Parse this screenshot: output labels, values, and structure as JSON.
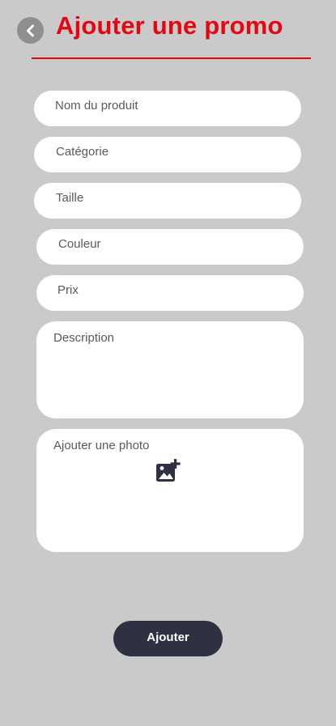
{
  "header": {
    "title": "Ajouter une promo",
    "back_icon": "chevron-left-icon",
    "title_color": "#e30613"
  },
  "form": {
    "product_name": {
      "placeholder": "Nom du produit",
      "value": ""
    },
    "category": {
      "placeholder": "Catégorie",
      "value": ""
    },
    "size": {
      "placeholder": "Taille",
      "value": ""
    },
    "color": {
      "placeholder": "Couleur",
      "value": ""
    },
    "price": {
      "placeholder": "Prix",
      "value": ""
    },
    "description": {
      "placeholder": "Description",
      "value": ""
    },
    "photo": {
      "label": "Ajouter une photo",
      "icon": "add-photo-icon"
    }
  },
  "actions": {
    "submit_label": "Ajouter",
    "submit_color": "#2e3141"
  },
  "theme": {
    "background": "#cacaca",
    "field_background": "#ffffff"
  }
}
